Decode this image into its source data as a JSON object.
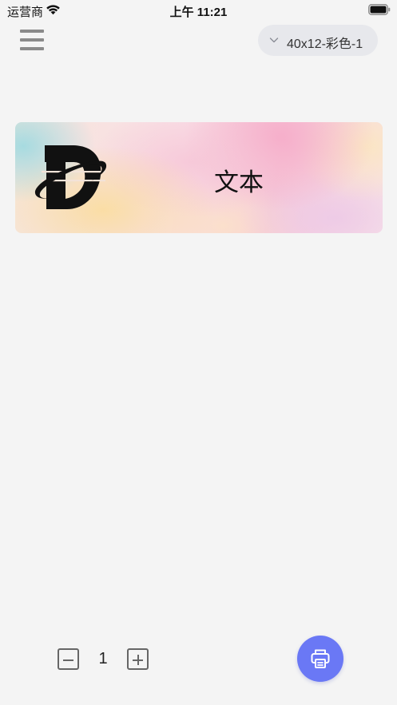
{
  "status_bar": {
    "carrier": "运营商",
    "time": "上午 11:21",
    "icons": [
      "wifi-icon",
      "battery-icon"
    ]
  },
  "header": {
    "menu_icon": "hamburger-menu-icon",
    "template_select": {
      "value": "40x12-彩色-1",
      "icon": "chevron-down-icon"
    }
  },
  "label": {
    "text": "文本",
    "logo": "logo-icon",
    "background": "pastel-watercolor"
  },
  "footer": {
    "copies": "1",
    "minus_icon": "minus-square-icon",
    "plus_icon": "plus-square-icon",
    "print_icon": "printer-icon"
  },
  "colors": {
    "background": "#f4f4f4",
    "accent": "#6a78f5",
    "select_bg": "#e7e8ec",
    "menu_icon": "#8a8a8a"
  }
}
